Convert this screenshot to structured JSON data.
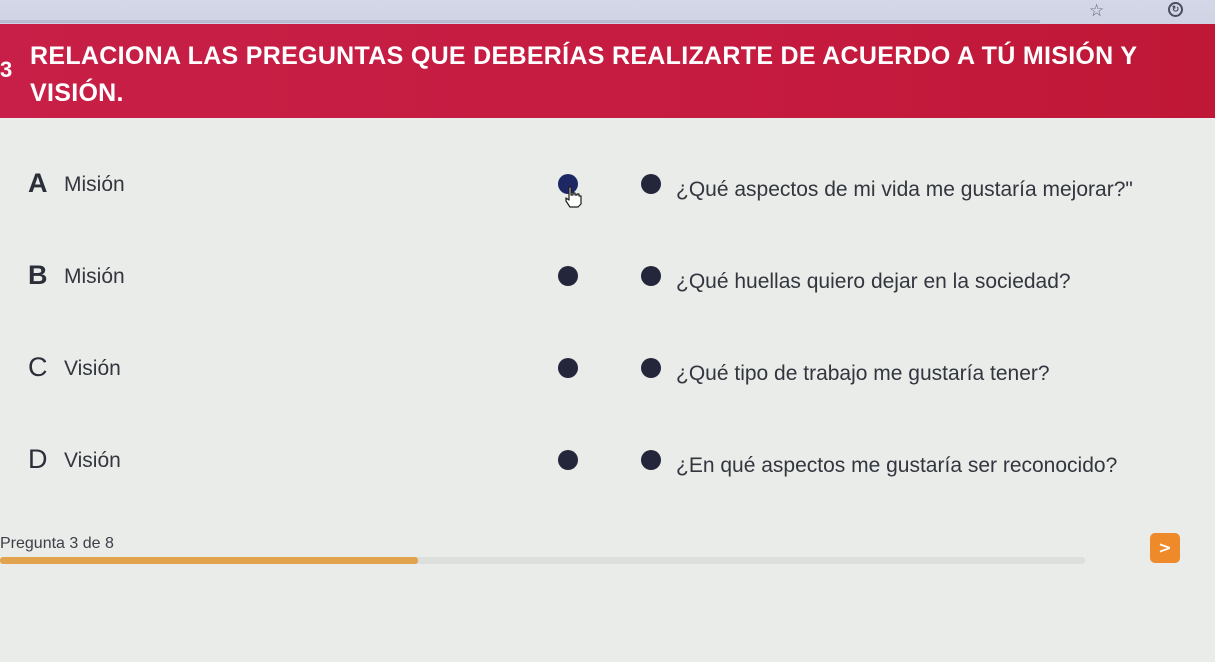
{
  "question": {
    "number": "3",
    "title": "Relaciona las preguntas que deberías realizarte de acuerdo a tú misión y visión."
  },
  "pairs": [
    {
      "letter": "A",
      "left": "Misión",
      "right": "¿Qué aspectos de mi vida me gustaría mejorar?\""
    },
    {
      "letter": "B",
      "left": "Misión",
      "right": "¿Qué huellas quiero dejar en la sociedad?"
    },
    {
      "letter": "C",
      "left": "Visión",
      "right": "¿Qué tipo de trabajo me gustaría tener?"
    },
    {
      "letter": "D",
      "left": "Visión",
      "right": "¿En qué aspectos me gustaría ser reconocido?"
    }
  ],
  "footer": {
    "counter": "Pregunta 3 de 8",
    "progress": 0.385,
    "next_label": ">"
  },
  "colors": {
    "header": "#c71f47",
    "progress": "#e2a34f",
    "next_button": "#ee8a2a"
  },
  "icons": {
    "bookmark": "star-icon",
    "extension": "extension-icon",
    "pointer": "hand-cursor-icon"
  }
}
